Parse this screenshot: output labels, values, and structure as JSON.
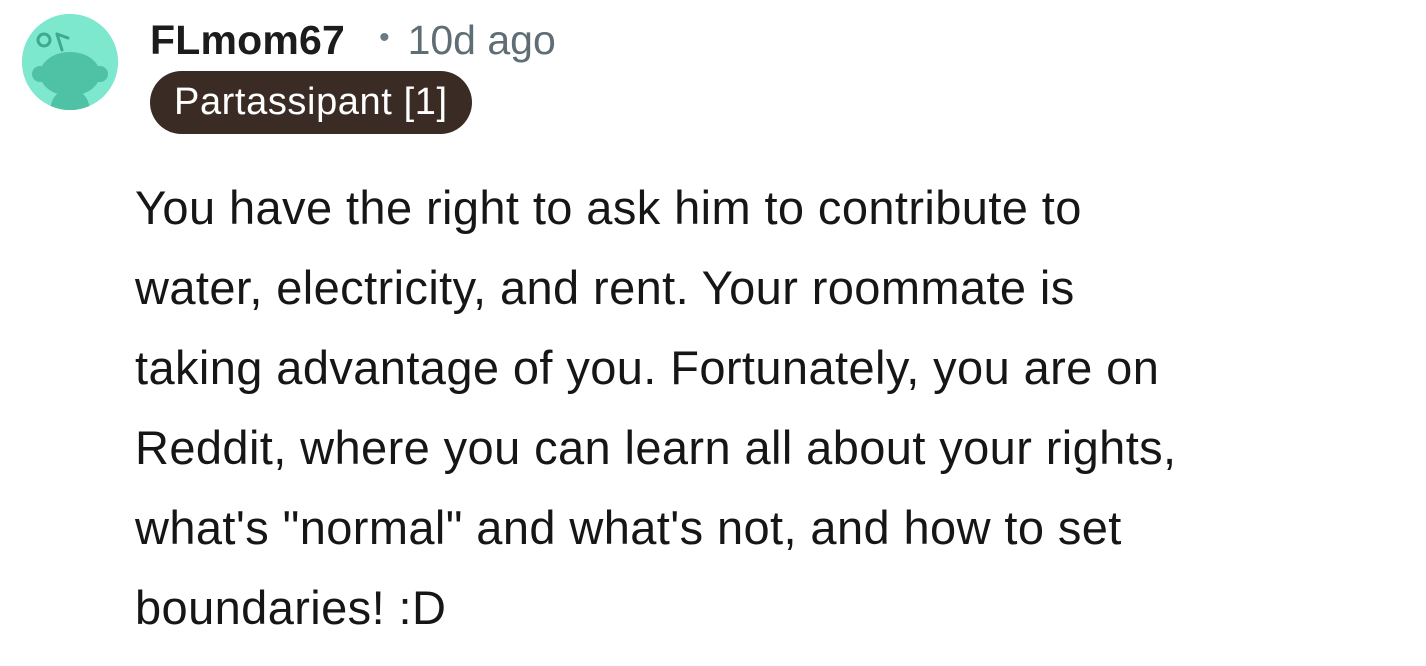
{
  "comment": {
    "username": "FLmom67",
    "separator": "•",
    "timestamp": "10d ago",
    "flair": "Partassipant [1]",
    "avatar_icon": "reddit-snoo-avatar-icon",
    "avatar_color": "#7ee8cf",
    "flair_color": "#3a2b25",
    "body_lines": [
      "You have the right to ask him to contribute to",
      "water, electricity, and rent. Your roommate is",
      "taking advantage of you. Fortunately, you are on",
      "Reddit, where you can learn all about your rights,",
      "what's \"normal\" and what's not, and how to set",
      "boundaries! :D"
    ]
  }
}
